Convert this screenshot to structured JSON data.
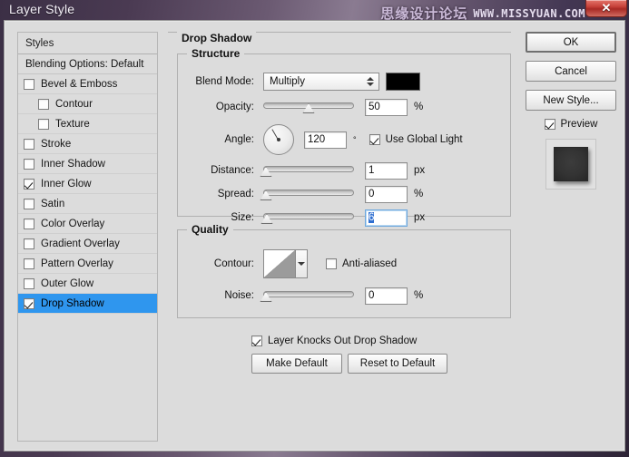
{
  "desktop": {
    "title": "Layer Style",
    "watermark_cn": "思缘设计论坛",
    "watermark_en": "WWW.MISSYUAN.COM",
    "close_glyph": "✕"
  },
  "styles_panel": {
    "header": "Styles",
    "items": [
      {
        "label": "Blending Options: Default",
        "checkbox": false,
        "indent": false,
        "selected": false,
        "has_checkbox": false
      },
      {
        "label": "Bevel & Emboss",
        "checkbox": false,
        "indent": false,
        "selected": false,
        "has_checkbox": true
      },
      {
        "label": "Contour",
        "checkbox": false,
        "indent": true,
        "selected": false,
        "has_checkbox": true
      },
      {
        "label": "Texture",
        "checkbox": false,
        "indent": true,
        "selected": false,
        "has_checkbox": true
      },
      {
        "label": "Stroke",
        "checkbox": false,
        "indent": false,
        "selected": false,
        "has_checkbox": true
      },
      {
        "label": "Inner Shadow",
        "checkbox": false,
        "indent": false,
        "selected": false,
        "has_checkbox": true
      },
      {
        "label": "Inner Glow",
        "checkbox": true,
        "indent": false,
        "selected": false,
        "has_checkbox": true
      },
      {
        "label": "Satin",
        "checkbox": false,
        "indent": false,
        "selected": false,
        "has_checkbox": true
      },
      {
        "label": "Color Overlay",
        "checkbox": false,
        "indent": false,
        "selected": false,
        "has_checkbox": true
      },
      {
        "label": "Gradient Overlay",
        "checkbox": false,
        "indent": false,
        "selected": false,
        "has_checkbox": true
      },
      {
        "label": "Pattern Overlay",
        "checkbox": false,
        "indent": false,
        "selected": false,
        "has_checkbox": true
      },
      {
        "label": "Outer Glow",
        "checkbox": false,
        "indent": false,
        "selected": false,
        "has_checkbox": true
      },
      {
        "label": "Drop Shadow",
        "checkbox": true,
        "indent": false,
        "selected": true,
        "has_checkbox": true
      }
    ],
    "selected_color": "#2f96ee"
  },
  "main": {
    "group_title": "Drop Shadow",
    "structure": {
      "legend": "Structure",
      "blend_mode_label": "Blend Mode:",
      "blend_mode_value": "Multiply",
      "shadow_color": "#000000",
      "opacity_label": "Opacity:",
      "opacity_value": "50",
      "opacity_unit": "%",
      "opacity_percent": 50,
      "angle_label": "Angle:",
      "angle_value": "120",
      "angle_unit": "°",
      "use_global_light_label": "Use Global Light",
      "use_global_light_checked": true,
      "distance_label": "Distance:",
      "distance_value": "1",
      "distance_unit": "px",
      "distance_percent": 2,
      "spread_label": "Spread:",
      "spread_value": "0",
      "spread_unit": "%",
      "spread_percent": 1,
      "size_label": "Size:",
      "size_value": "6",
      "size_unit": "px",
      "size_percent": 4,
      "size_focused": true
    },
    "quality": {
      "legend": "Quality",
      "contour_label": "Contour:",
      "anti_aliased_label": "Anti-aliased",
      "anti_aliased_checked": false,
      "noise_label": "Noise:",
      "noise_value": "0",
      "noise_unit": "%",
      "noise_percent": 1
    },
    "knockout_label": "Layer Knocks Out Drop Shadow",
    "knockout_checked": true,
    "make_default_label": "Make Default",
    "reset_default_label": "Reset to Default"
  },
  "right": {
    "ok_label": "OK",
    "cancel_label": "Cancel",
    "new_style_label": "New Style...",
    "preview_label": "Preview",
    "preview_checked": true
  }
}
